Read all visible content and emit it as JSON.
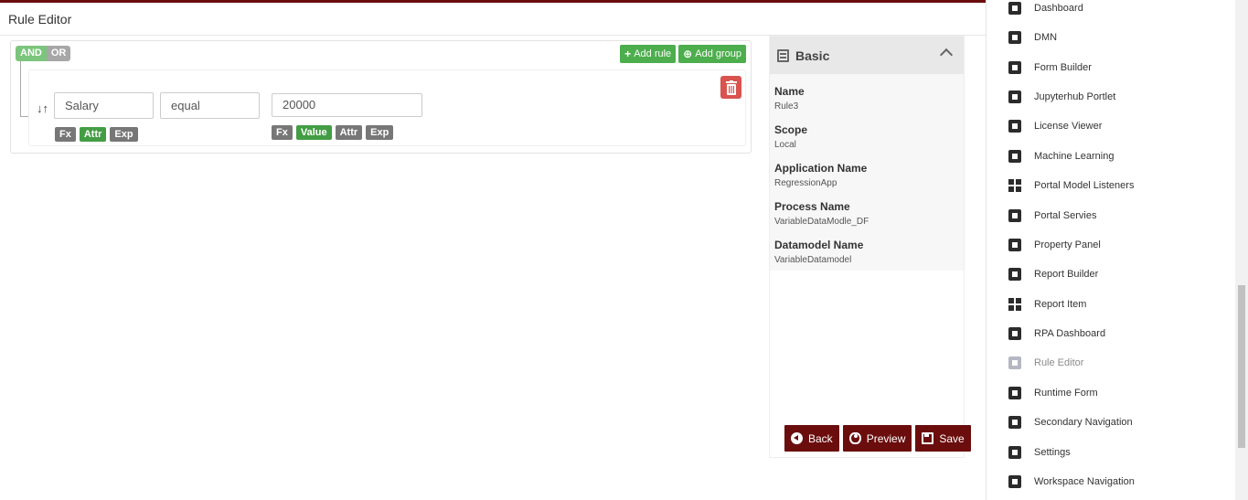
{
  "header": {
    "title": "Rule Editor"
  },
  "builder": {
    "conditions": [
      "AND",
      "OR"
    ],
    "add_rule": "Add rule",
    "add_group": "Add group",
    "rule": {
      "attribute": "Salary",
      "operator": "equal",
      "value": "20000",
      "left_modes": [
        "Fx",
        "Attr",
        "Exp"
      ],
      "right_modes": [
        "Fx",
        "Value",
        "Attr",
        "Exp"
      ]
    }
  },
  "props": {
    "section_title": "Basic",
    "fields": [
      {
        "label": "Name",
        "value": "Rule3"
      },
      {
        "label": "Scope",
        "value": "Local"
      },
      {
        "label": "Application Name",
        "value": "RegressionApp"
      },
      {
        "label": "Process Name",
        "value": "VariableDataModle_DF"
      },
      {
        "label": "Datamodel Name",
        "value": "VariableDatamodel"
      }
    ]
  },
  "actions": {
    "back": "Back",
    "preview": "Preview",
    "save": "Save"
  },
  "sidebar": {
    "items": [
      {
        "label": "Dashboard",
        "icon": "square-icon"
      },
      {
        "label": "DMN",
        "icon": "square-icon"
      },
      {
        "label": "Form Builder",
        "icon": "square-icon"
      },
      {
        "label": "Jupyterhub Portlet",
        "icon": "square-icon"
      },
      {
        "label": "License Viewer",
        "icon": "square-icon"
      },
      {
        "label": "Machine Learning",
        "icon": "square-icon"
      },
      {
        "label": "Portal Model Listeners",
        "icon": "grid-icon"
      },
      {
        "label": "Portal Servies",
        "icon": "square-icon"
      },
      {
        "label": "Property Panel",
        "icon": "square-icon"
      },
      {
        "label": "Report Builder",
        "icon": "square-icon"
      },
      {
        "label": "Report Item",
        "icon": "grid-icon"
      },
      {
        "label": "RPA Dashboard",
        "icon": "square-icon"
      },
      {
        "label": "Rule Editor",
        "icon": "square-icon",
        "active": true
      },
      {
        "label": "Runtime Form",
        "icon": "square-icon"
      },
      {
        "label": "Secondary Navigation",
        "icon": "square-icon"
      },
      {
        "label": "Settings",
        "icon": "square-icon"
      },
      {
        "label": "Workspace Navigation",
        "icon": "square-icon"
      }
    ]
  },
  "colors": {
    "brand": "#6b0d0d",
    "success": "#4cae4c",
    "danger": "#d9534f"
  }
}
